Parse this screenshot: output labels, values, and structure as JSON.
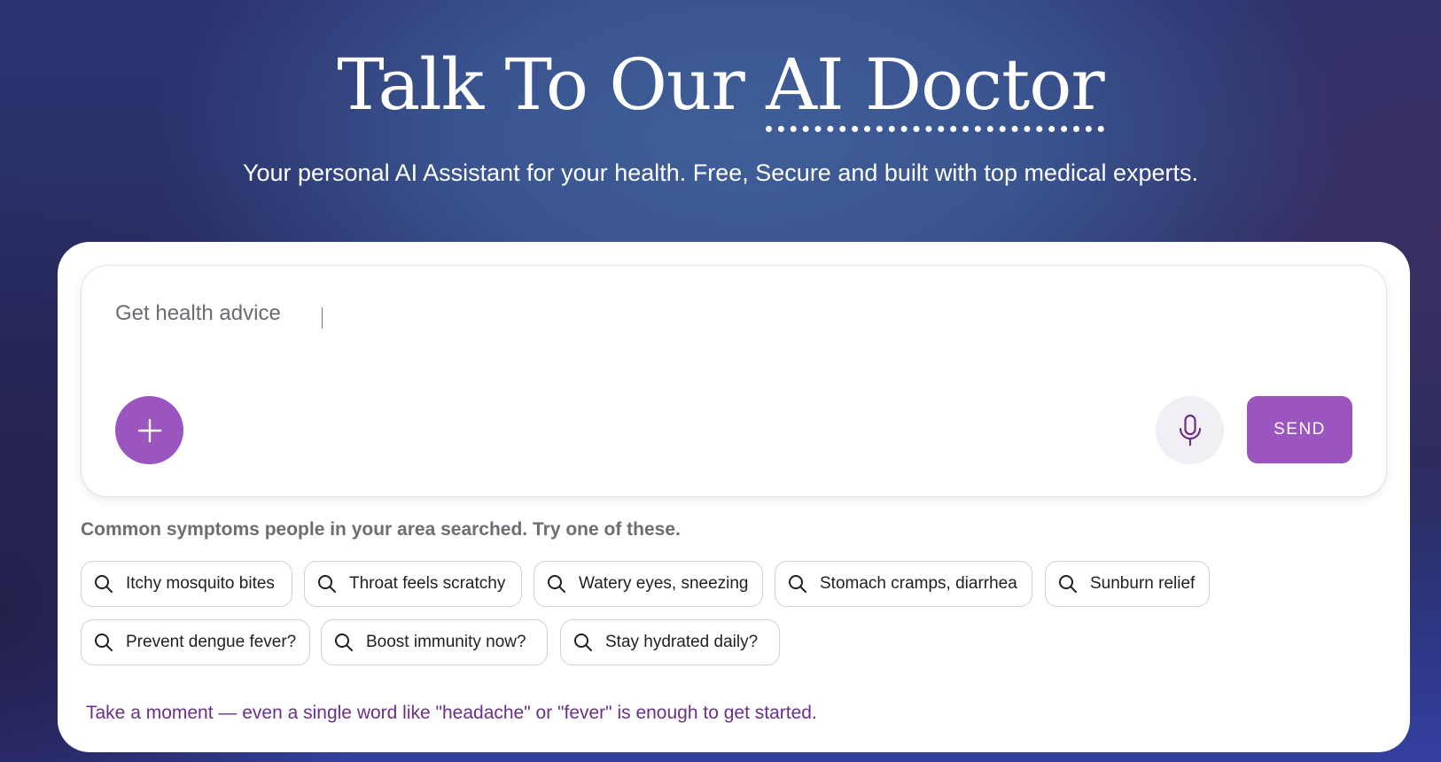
{
  "hero": {
    "title_main": "Talk To Our ",
    "title_accent": "AI Doctor",
    "subtitle": "Your personal AI Assistant for your health. Free, Secure and built with top medical experts."
  },
  "composer": {
    "placeholder": "Get health advice",
    "value": "",
    "send_label": "SEND",
    "plus_icon": "plus-icon",
    "mic_icon": "microphone-icon"
  },
  "suggestions": {
    "label": "Common symptoms people in your area searched. Try one of these.",
    "items": [
      "Itchy mosquito bites",
      "Throat feels scratchy",
      "Watery eyes, sneezing",
      "Stomach cramps, diarrhea",
      "Sunburn relief",
      "Prevent dengue fever?",
      "Boost immunity now?",
      "Stay hydrated daily?"
    ]
  },
  "hint": "Take a moment — even a single word like \"headache\" or \"fever\" is enough to get started.",
  "colors": {
    "accent": "#9b55bf",
    "hint_text": "#6a2f86",
    "mic_bg": "#f1eff5"
  }
}
